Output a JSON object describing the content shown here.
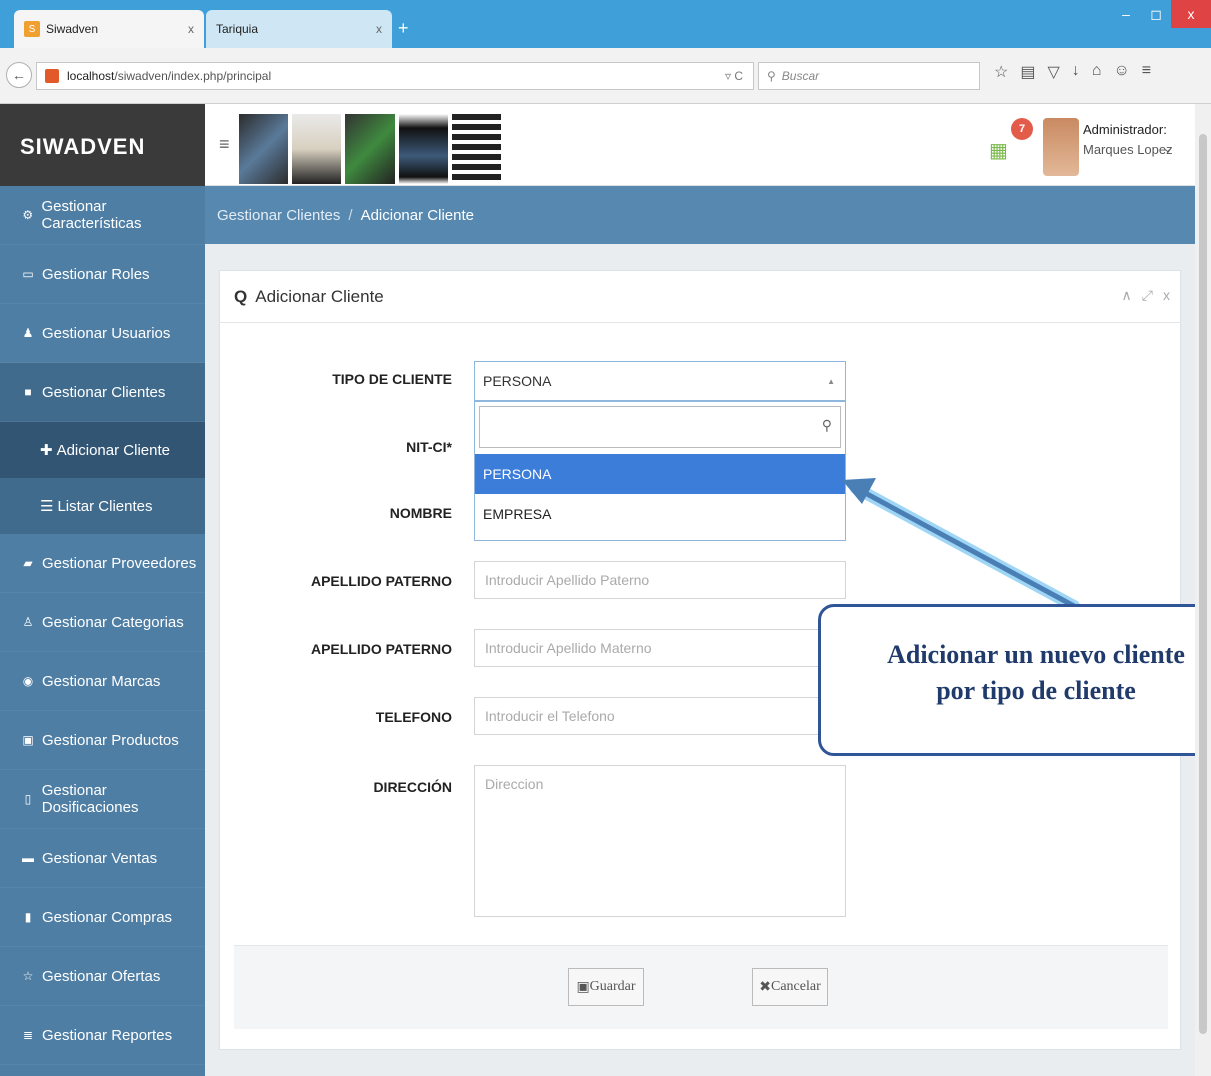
{
  "browser": {
    "tabs": [
      {
        "label": "Siwadven",
        "close": "x"
      },
      {
        "label": "Tariquia",
        "close": "x"
      }
    ],
    "new_tab": "+",
    "url_host": "localhost",
    "url_path": "/siwadven/index.php/principal",
    "reload": "▿ C",
    "search_placeholder": "Buscar"
  },
  "app": {
    "brand": "SIWADVEN",
    "notification_count": "7",
    "user_role": "Administrador:",
    "user_name": "Marques Lopez"
  },
  "sidebar": {
    "items": [
      {
        "label": "Gestionar Características",
        "icon": "cogs-icon"
      },
      {
        "label": "Gestionar Roles",
        "icon": "card-icon"
      },
      {
        "label": "Gestionar Usuarios",
        "icon": "users-icon"
      },
      {
        "label": "Gestionar Clientes",
        "icon": "briefcase-icon"
      }
    ],
    "sub_items": [
      {
        "label": "Adicionar Cliente",
        "icon": "plus-icon"
      },
      {
        "label": "Listar Clientes",
        "icon": "list-icon"
      }
    ],
    "more_items": [
      {
        "label": "Gestionar Proveedores",
        "icon": "truck-icon"
      },
      {
        "label": "Gestionar Categorias",
        "icon": "sitemap-icon"
      },
      {
        "label": "Gestionar Marcas",
        "icon": "dot-circle-icon"
      },
      {
        "label": "Gestionar Productos",
        "icon": "image-icon"
      },
      {
        "label": "Gestionar Dosificaciones",
        "icon": "file-icon"
      },
      {
        "label": "Gestionar Ventas",
        "icon": "cart-icon"
      },
      {
        "label": "Gestionar Compras",
        "icon": "book-icon"
      },
      {
        "label": "Gestionar Ofertas",
        "icon": "star-icon"
      },
      {
        "label": "Gestionar Reportes",
        "icon": "list-alt-icon"
      }
    ]
  },
  "breadcrumb": {
    "parent": "Gestionar Clientes",
    "separator": "/",
    "current": "Adicionar Cliente"
  },
  "panel": {
    "title": "Adicionar Cliente"
  },
  "form": {
    "tipo_label": "TIPO DE CLIENTE",
    "tipo_value": "PERSONA",
    "options": [
      "PERSONA",
      "EMPRESA"
    ],
    "nit_label": "NIT-CI*",
    "nombre_label": "NOMBRE",
    "ap_paterno_label": "APELLIDO PATERNO",
    "ap_paterno_placeholder": "Introducir Apellido Paterno",
    "ap_materno_label": "APELLIDO PATERNO",
    "ap_materno_placeholder": "Introducir Apellido Materno",
    "telefono_label": "TELEFONO",
    "telefono_placeholder": "Introducir el Telefono",
    "direccion_label": "DIRECCIÓN",
    "direccion_placeholder": "Direccion",
    "save": "Guardar",
    "cancel": "Cancelar"
  },
  "callout": {
    "line1": "Adicionar un nuevo cliente",
    "line2": "por tipo de cliente"
  },
  "colors": {
    "sidebar": "#4f7ea4",
    "breadcrumb": "#5789b0",
    "selected_option": "#3b7dd8",
    "callout_border": "#2f5597"
  }
}
